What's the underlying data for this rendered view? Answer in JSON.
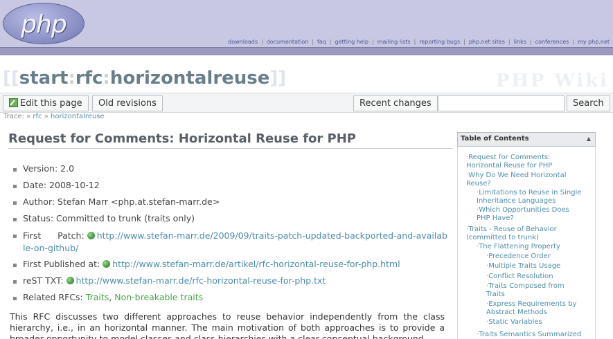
{
  "header": {
    "logo_text": "php",
    "nav": [
      "downloads",
      "documentation",
      "faq",
      "getting help",
      "mailing lists",
      "reporting bugs",
      "php.net sites",
      "links",
      "conferences",
      "my php.net"
    ]
  },
  "page_title": {
    "open": "[[",
    "seg1": "start",
    "colon1": ":",
    "seg2": "rfc",
    "colon2": ":",
    "seg3": "horizontalreuse",
    "close": "]]",
    "wiki_brand": "PHP Wiki"
  },
  "toolbar": {
    "edit_label": "Edit this page",
    "old_revisions_label": "Old revisions",
    "recent_changes_label": "Recent changes",
    "search_value": "",
    "search_label": "Search"
  },
  "trace": {
    "label": "Trace:",
    "items": [
      "rfc",
      "horizontalreuse"
    ]
  },
  "main": {
    "heading": "Request for Comments: Horizontal Reuse for PHP",
    "version": "Version: 2.0",
    "date": "Date: 2008-10-12",
    "author": "Author: Stefan Marr <php.at.stefan-marr.de>",
    "status": "Status: Committed to trunk (traits only)",
    "first_patch_label": "First      Patch:",
    "first_patch_link": "http://www.stefan-marr.de/2009/09/traits-patch-updated-backported-and-available-on-github/",
    "first_published_label": "First Published at:",
    "first_published_link": "http://www.stefan-marr.de/artikel/rfc-horizontal-reuse-for-php.html",
    "rest_label": "reST TXT:",
    "rest_link": "http://www.stefan-marr.de/rfc-horizontal-reuse-for-php.txt",
    "related_label": "Related RFCs:",
    "related_1": "Traits",
    "related_sep": ",",
    "related_2": "Non-breakable traits",
    "paragraph": "This RFC discusses two different approaches to reuse behavior independently from the class hierarchy, i.e., in an horizontal manner. The main motivation of both approaches is to provide a broader opportunity to model classes and class hierarchies with a clear conceptual background"
  },
  "toc": {
    "title": "Table of Contents",
    "items": [
      {
        "text": "Request for Comments: Horizontal Reuse for PHP",
        "level": 1
      },
      {
        "text": "Why Do We Need Horizontal Reuse?",
        "level": 1
      },
      {
        "text": "Limitations to Reuse in Single Inheritance Languages",
        "level": 2
      },
      {
        "text": "Which Opportunities Does PHP Have?",
        "level": 2
      },
      {
        "text": "Traits - Reuse of Behavior (committed to trunk)",
        "level": 1
      },
      {
        "text": "The Flattening Property",
        "level": 2
      },
      {
        "text": "Precedence Order",
        "level": 3
      },
      {
        "text": "Multiple Traits Usage",
        "level": 3
      },
      {
        "text": "Conflict Resolution",
        "level": 3
      },
      {
        "text": "Traits Composed from Traits",
        "level": 3
      },
      {
        "text": "Express Requirements by Abstract Methods",
        "level": 3
      },
      {
        "text": "Static Variables",
        "level": 3
      },
      {
        "text": "Traits Semantics Summarized",
        "level": 2
      }
    ]
  }
}
